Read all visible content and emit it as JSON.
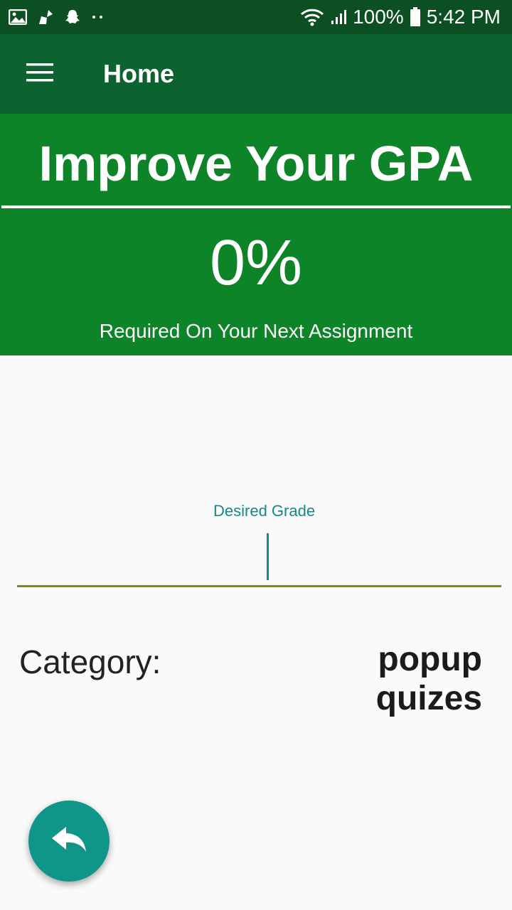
{
  "status_bar": {
    "left_icons": [
      "image-icon",
      "cleaner-icon",
      "snapchat-icon",
      "more-dots-icon"
    ],
    "battery": "100%",
    "time": "5:42 PM"
  },
  "app_bar": {
    "title": "Home"
  },
  "hero": {
    "title": "Improve Your GPA",
    "percent": "0%",
    "caption": "Required On Your Next Assignment"
  },
  "form": {
    "desired_grade_label": "Desired Grade",
    "desired_grade_value": "",
    "category_label": "Category:",
    "category_value": "popup quizes"
  },
  "colors": {
    "status_bar": "#0b4f23",
    "app_bar": "#0c6330",
    "hero": "#0d8428",
    "accent": "#138a88",
    "underline": "#6d9617",
    "fab": "#0f9688"
  }
}
